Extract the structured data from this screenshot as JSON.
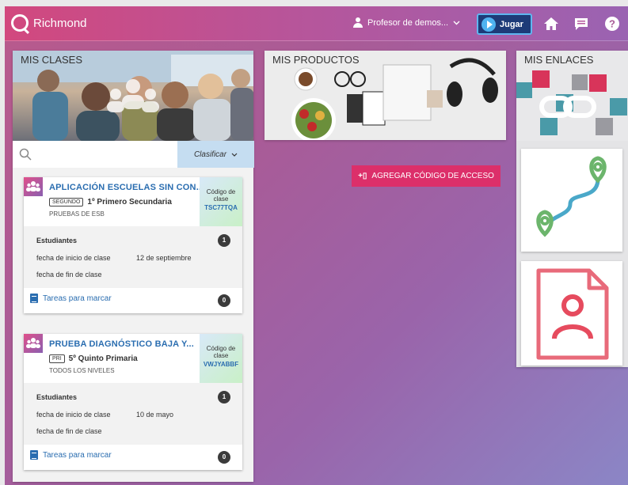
{
  "header": {
    "brand": "Richmond",
    "user_label": "Profesor de demos...",
    "play_label": "Jugar"
  },
  "classes": {
    "title": "MIS CLASES",
    "classify_label": "Clasificar",
    "cards": [
      {
        "title": "APLICACIÓN ESCUELAS SIN CON...",
        "level_tag": "SEGUNDO",
        "grade": "1º Primero Secundaria",
        "subtitle": "PRUEBAS DE ESB",
        "code_label": "Código de clase",
        "code": "TSC77TQA",
        "students_label": "Estudiantes",
        "students_count": "1",
        "start_label": "fecha de inicio de clase",
        "start_value": "12 de septiembre",
        "end_label": "fecha de fin de clase",
        "tasks_label": "Tareas para marcar",
        "tasks_count": "0"
      },
      {
        "title": "PRUEBA DIAGNÓSTICO BAJA Y...",
        "level_tag": "PRI",
        "grade": "5º Quinto Primaria",
        "subtitle": "TODOS LOS NIVELES",
        "code_label": "Código de clase",
        "code": "VWJYABBF",
        "students_label": "Estudiantes",
        "students_count": "1",
        "start_label": "fecha de inicio de clase",
        "start_value": "10 de mayo",
        "end_label": "fecha de fin de clase",
        "tasks_label": "Tareas para marcar",
        "tasks_count": "0"
      }
    ]
  },
  "products": {
    "title": "MIS PRODUCTOS",
    "add_code_label": "AGREGAR CÓDIGO DE ACCESO"
  },
  "links": {
    "title": "MIS ENLACES"
  },
  "colors": {
    "brand": "#d2487e",
    "link": "#2a6db0",
    "add_button": "#dc2f6a"
  }
}
